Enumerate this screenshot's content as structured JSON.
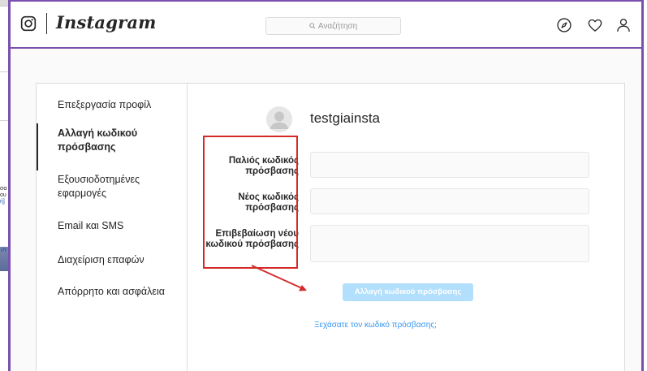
{
  "background_window": {
    "snippets": [
      "σα",
      "ου",
      "ή]",
      "ργ"
    ]
  },
  "header": {
    "brand": "Instagram",
    "search": {
      "placeholder": "Αναζήτηση"
    },
    "icons": [
      "instagram-camera-icon",
      "search-icon",
      "compass-icon",
      "heart-icon",
      "profile-icon"
    ]
  },
  "sidebar": {
    "items": [
      {
        "label": "Επεξεργασία προφίλ",
        "active": false
      },
      {
        "label": "Αλλαγή κωδικού πρόσβασης",
        "active": true
      },
      {
        "label": "Εξουσιοδοτημένες εφαρμογές",
        "active": false
      },
      {
        "label": "Email και SMS",
        "active": false
      },
      {
        "label": "Διαχείριση επαφών",
        "active": false
      },
      {
        "label": "Απόρρητο και ασφάλεια",
        "active": false
      }
    ]
  },
  "profile": {
    "username": "testgiainsta"
  },
  "form": {
    "old_password_label": "Παλιός κωδικός πρόσβασης",
    "new_password_label": "Νέος κωδικός πρόσβασης",
    "confirm_password_label": "Επιβεβαίωση νέου κωδικού πρόσβασης",
    "old_password_value": "",
    "new_password_value": "",
    "confirm_password_value": "",
    "submit_label": "Αλλαγή κωδικού πρόσβασης",
    "forgot_label": "Ξεχάσατε τον κωδικό πρόσβασης;"
  },
  "colors": {
    "window_frame": "#7b4fb0",
    "annotation": "#d42a2a",
    "button_disabled": "#b2dffc",
    "link": "#3897f0"
  }
}
